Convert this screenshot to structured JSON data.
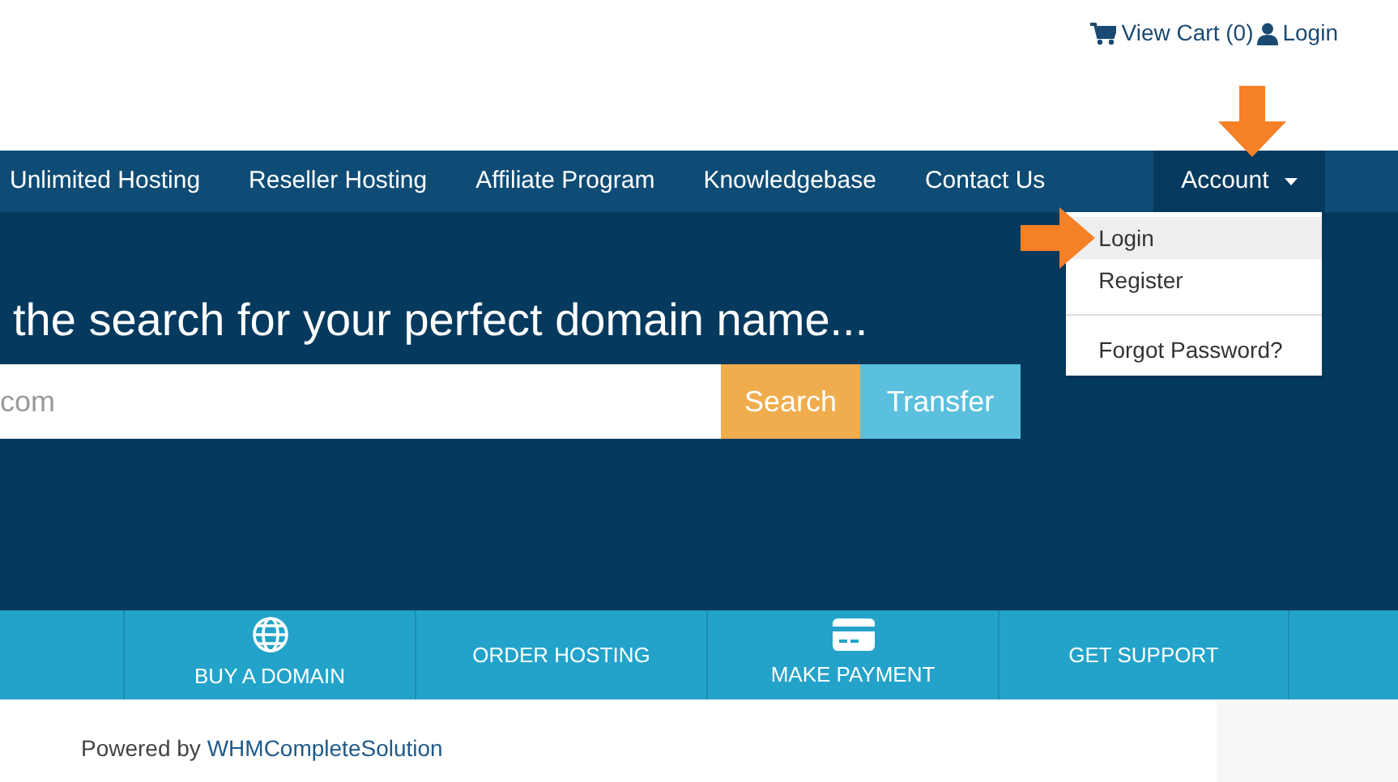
{
  "top_links": [
    {
      "kind": "cart",
      "label": "View Cart (0)"
    },
    {
      "kind": "user",
      "label": "Login"
    }
  ],
  "nav": {
    "items": [
      {
        "label": "Unlimited Hosting"
      },
      {
        "label": "Reseller Hosting"
      },
      {
        "label": "Affiliate Program"
      },
      {
        "label": "Knowledgebase"
      },
      {
        "label": "Contact Us"
      }
    ],
    "account": {
      "label": "Account",
      "expanded": true,
      "menu": [
        {
          "label": "Login",
          "selected": true
        },
        {
          "label": "Register",
          "selected": false
        },
        {
          "kind": "divider"
        },
        {
          "label": "Forgot Password?",
          "selected": false
        }
      ]
    }
  },
  "hero": {
    "title": "the search for your perfect domain name...",
    "search": {
      "placeholder": "com"
    },
    "buttons": [
      {
        "kind": "search",
        "label": "Search"
      },
      {
        "kind": "transfer",
        "label": "Transfer"
      }
    ]
  },
  "actions": [
    {
      "kind": "globe",
      "label": "BUY A DOMAIN"
    },
    {
      "kind": "plain",
      "label": "ORDER HOSTING"
    },
    {
      "kind": "card",
      "label": "MAKE PAYMENT"
    },
    {
      "kind": "plain",
      "label": "GET SUPPORT"
    }
  ],
  "footer": {
    "text": "Powered by",
    "link": "WHMCompleteSolution"
  }
}
